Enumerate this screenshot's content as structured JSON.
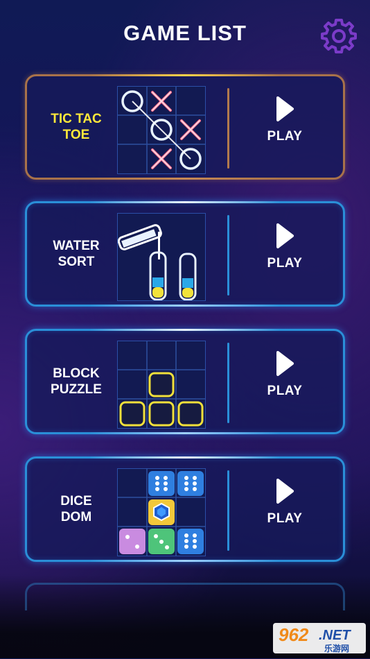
{
  "header": {
    "title": "GAME LIST",
    "settings_icon": "gear-icon"
  },
  "games": [
    {
      "name": "TIC TAC\nTOE",
      "play_label": "PLAY",
      "active": true
    },
    {
      "name": "WATER\nSORT",
      "play_label": "PLAY",
      "active": false
    },
    {
      "name": "BLOCK\nPUZZLE",
      "play_label": "PLAY",
      "active": false
    },
    {
      "name": "DICE\nDOM",
      "play_label": "PLAY",
      "active": false
    }
  ],
  "watermark": {
    "top": "962",
    "suffix": ".NET",
    "bottom": "乐游网"
  },
  "colors": {
    "active_border": "#a8724a",
    "card_border": "#2a8fd8",
    "active_text": "#ffe83a",
    "accent_purple": "#7b3bc8"
  }
}
